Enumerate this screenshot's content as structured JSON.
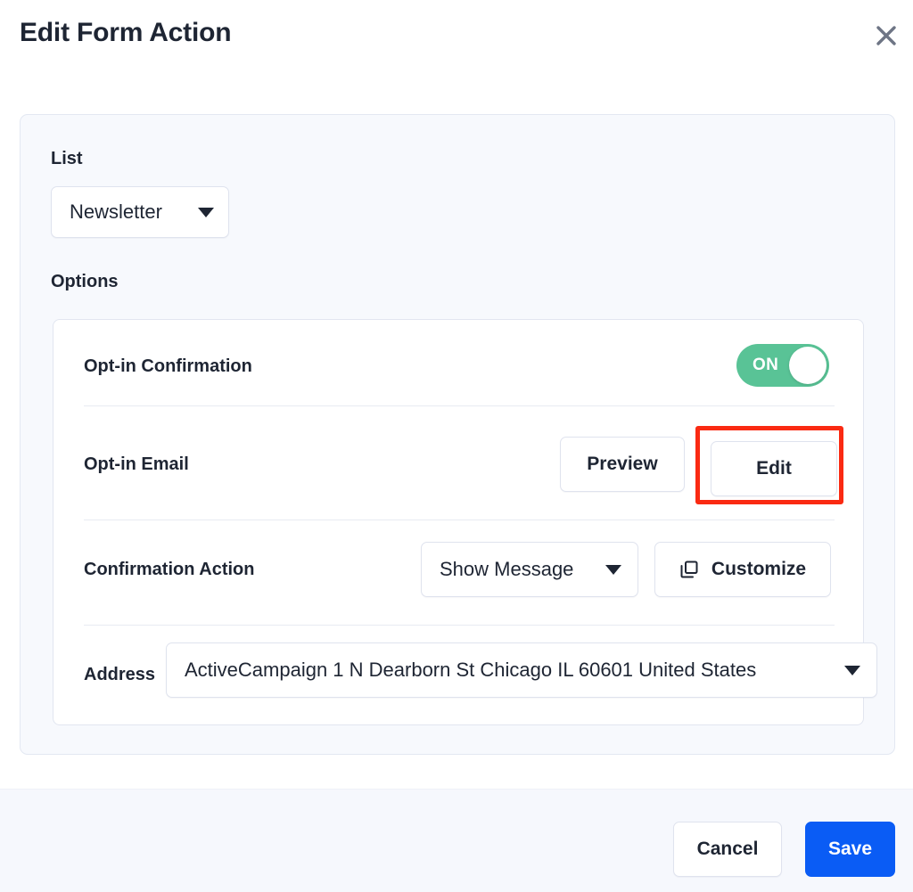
{
  "header": {
    "title": "Edit Form Action",
    "close_icon": "close-icon"
  },
  "form": {
    "list": {
      "label": "List",
      "selected": "Newsletter",
      "caret_icon": "chevron-down-icon"
    },
    "options_label": "Options",
    "rows": {
      "optin_confirmation": {
        "label": "Opt-in Confirmation",
        "toggle_state": "ON",
        "toggle_color": "#59c396"
      },
      "optin_email": {
        "label": "Opt-in Email",
        "preview_label": "Preview",
        "edit_label": "Edit",
        "highlight_color": "#fa2a12"
      },
      "confirmation_action": {
        "label": "Confirmation Action",
        "selected": "Show Message",
        "customize_label": "Customize",
        "customize_icon": "duplicate-icon",
        "caret_icon": "chevron-down-icon"
      },
      "address": {
        "label": "Address",
        "selected": "ActiveCampaign 1 N Dearborn St Chicago IL 60601 United States",
        "caret_icon": "chevron-down-icon"
      }
    }
  },
  "footer": {
    "cancel_label": "Cancel",
    "save_label": "Save",
    "save_color": "#0a5cf5"
  }
}
